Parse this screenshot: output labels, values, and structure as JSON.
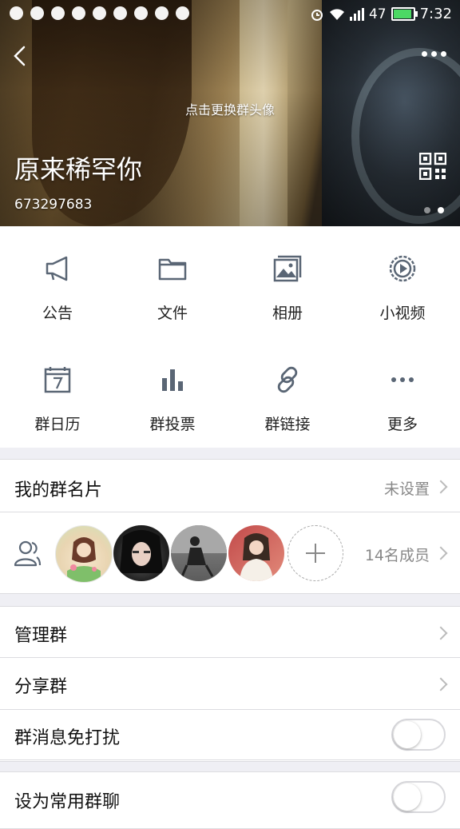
{
  "status_bar": {
    "signal_text": "47",
    "time": "7:32",
    "battery_level": 0.95,
    "battery_color": "#4cd964"
  },
  "header": {
    "change_avatar_hint": "点击更换群头像",
    "group_name": "原来稀罕你",
    "group_id": "673297683",
    "page_dots": {
      "count": 2,
      "active_index": 1
    }
  },
  "features": [
    {
      "label": "公告",
      "icon": "megaphone-icon"
    },
    {
      "label": "文件",
      "icon": "folder-icon"
    },
    {
      "label": "相册",
      "icon": "photo-album-icon"
    },
    {
      "label": "小视频",
      "icon": "video-icon"
    },
    {
      "label": "群日历",
      "icon": "calendar-icon"
    },
    {
      "label": "群投票",
      "icon": "bar-chart-icon"
    },
    {
      "label": "群链接",
      "icon": "link-icon"
    },
    {
      "label": "更多",
      "icon": "more-icon"
    }
  ],
  "my_card": {
    "title": "我的群名片",
    "value": "未设置"
  },
  "members": {
    "count_text": "14名成员"
  },
  "settings": {
    "manage": "管理群",
    "share": "分享群",
    "mute": {
      "label": "群消息免打扰",
      "on": false
    },
    "favorite": {
      "label": "设为常用群聊",
      "on": false
    }
  },
  "colors": {
    "icon_gray": "#5a6675",
    "accent": "#4cd964"
  }
}
